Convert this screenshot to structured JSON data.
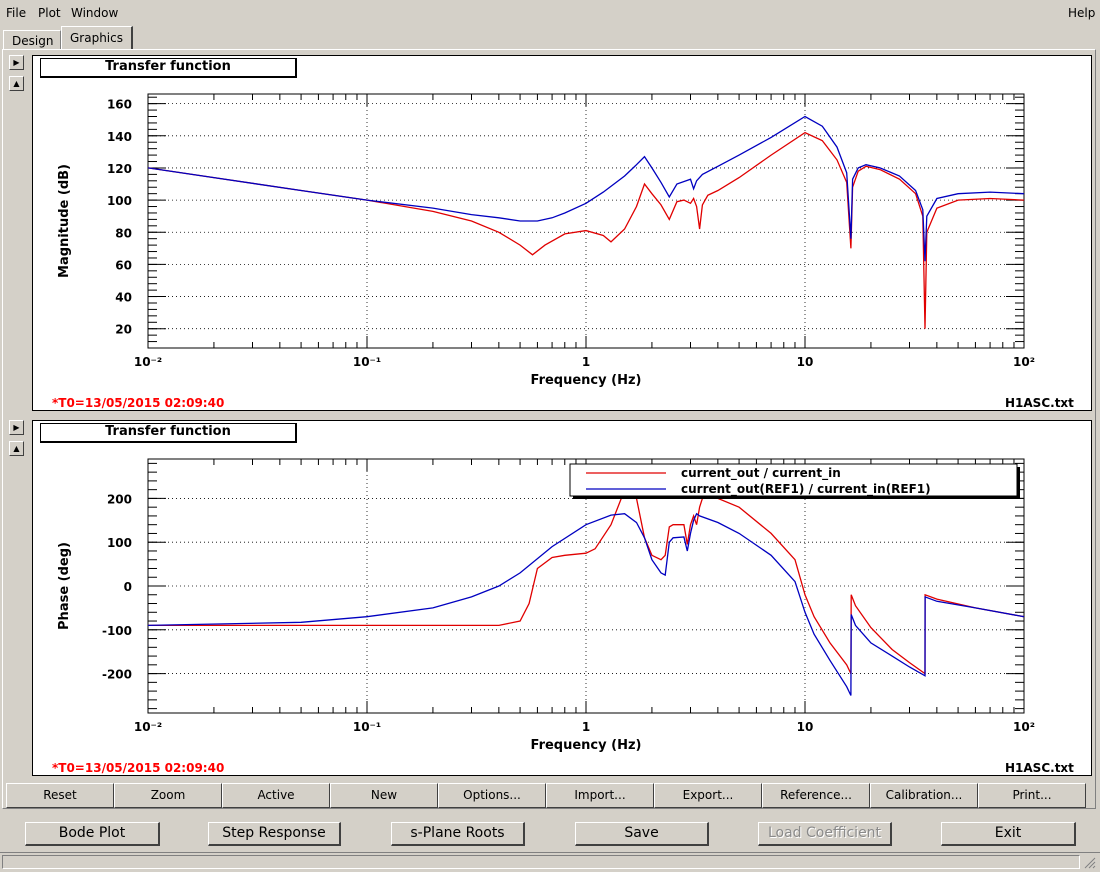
{
  "menu": {
    "file": "File",
    "plot": "Plot",
    "window": "Window",
    "help": "Help"
  },
  "tabs": [
    {
      "label": "Design"
    },
    {
      "label": "Graphics"
    }
  ],
  "panels": {
    "up_arrow": "▲",
    "down_arrow": "▲",
    "right_arrow": "▶"
  },
  "footer_info": {
    "t0": "*T0=13/05/2015 02:09:40",
    "filename": "H1ASC.txt"
  },
  "toolbar": [
    "Reset",
    "Zoom",
    "Active",
    "New",
    "Options...",
    "Import...",
    "Export...",
    "Reference...",
    "Calibration...",
    "Print..."
  ],
  "actions": {
    "bode": "Bode Plot",
    "step": "Step Response",
    "splane": "s-Plane Roots",
    "save": "Save",
    "load": "Load Coefficient",
    "exit": "Exit"
  },
  "colors": {
    "series1": "#e00000",
    "series2": "#0000c0"
  },
  "chart_data": [
    {
      "type": "line",
      "title": "Transfer function",
      "xlabel": "Frequency (Hz)",
      "ylabel": "Magnitude (dB)",
      "xscale": "log",
      "xlim": [
        0.01,
        100
      ],
      "ylim": [
        8,
        166
      ],
      "xticks": [
        0.01,
        0.1,
        1,
        10,
        100
      ],
      "xticklabels": [
        "10⁻²",
        "10⁻¹",
        "1",
        "10",
        "10²"
      ],
      "yticks": [
        20,
        40,
        60,
        80,
        100,
        120,
        140,
        160
      ],
      "grid": true,
      "series": [
        {
          "name": "current_out / current_in",
          "x": [
            0.01,
            0.02,
            0.05,
            0.1,
            0.2,
            0.3,
            0.4,
            0.5,
            0.57,
            0.65,
            0.8,
            1.0,
            1.2,
            1.3,
            1.5,
            1.7,
            1.85,
            2.0,
            2.2,
            2.4,
            2.6,
            2.8,
            3.0,
            3.1,
            3.2,
            3.3,
            3.4,
            3.6,
            4.0,
            5.0,
            7.0,
            10.0,
            12.0,
            14.0,
            15.5,
            16.2,
            16.5,
            17.5,
            19.0,
            22.0,
            27.0,
            32.0,
            34.5,
            35.3,
            36.0,
            40.0,
            50.0,
            70.0,
            100.0
          ],
          "y": [
            120,
            114,
            106,
            100,
            93,
            87,
            80,
            72,
            66,
            72,
            79,
            81,
            78,
            74,
            82,
            96,
            110,
            104,
            97,
            88,
            99,
            100,
            98,
            101,
            96,
            82,
            97,
            103,
            106,
            114,
            128,
            142,
            137,
            125,
            111,
            70,
            108,
            118,
            121,
            119,
            113,
            104,
            90,
            20,
            80,
            95,
            100,
            101,
            100
          ]
        },
        {
          "name": "current_out(REF1) / current_in(REF1)",
          "x": [
            0.01,
            0.02,
            0.05,
            0.1,
            0.2,
            0.3,
            0.4,
            0.5,
            0.6,
            0.7,
            0.8,
            1.0,
            1.2,
            1.5,
            1.7,
            1.85,
            2.0,
            2.2,
            2.4,
            2.6,
            3.0,
            3.1,
            3.2,
            3.4,
            4.0,
            5.0,
            7.0,
            10.0,
            12.0,
            14.0,
            15.5,
            16.2,
            16.5,
            17.5,
            19.0,
            22.0,
            27.0,
            32.0,
            34.5,
            35.3,
            36.0,
            40.0,
            50.0,
            70.0,
            100.0
          ],
          "y": [
            120,
            114,
            106,
            100,
            95,
            91,
            89,
            87,
            87,
            89,
            92,
            98,
            105,
            115,
            122,
            127,
            120,
            111,
            102,
            110,
            113,
            107,
            112,
            116,
            121,
            128,
            139,
            152,
            146,
            133,
            117,
            76,
            113,
            120,
            122,
            120,
            115,
            106,
            94,
            62,
            90,
            101,
            104,
            105,
            104
          ]
        }
      ]
    },
    {
      "type": "line",
      "title": "Transfer function",
      "xlabel": "Frequency (Hz)",
      "ylabel": "Phase (deg)",
      "xscale": "log",
      "xlim": [
        0.01,
        100
      ],
      "ylim": [
        -290,
        290
      ],
      "xticks": [
        0.01,
        0.1,
        1,
        10,
        100
      ],
      "xticklabels": [
        "10⁻²",
        "10⁻¹",
        "1",
        "10",
        "10²"
      ],
      "yticks": [
        -200,
        -100,
        0,
        100,
        200
      ],
      "grid": true,
      "legend": "top-right",
      "series": [
        {
          "name": "current_out / current_in",
          "x": [
            0.01,
            0.05,
            0.2,
            0.4,
            0.5,
            0.55,
            0.6,
            0.7,
            0.8,
            1.0,
            1.1,
            1.3,
            1.45,
            1.7,
            1.85,
            2.0,
            2.2,
            2.3,
            2.4,
            2.5,
            2.8,
            2.9,
            3.0,
            3.1,
            3.2,
            3.3,
            3.4,
            4.0,
            5.0,
            7.0,
            9.0,
            10.0,
            11.0,
            13.0,
            15.5,
            16.2,
            16.25,
            17.0,
            20.0,
            25.0,
            30.0,
            35.3,
            35.35,
            40.0,
            60.0,
            100.0
          ],
          "y": [
            -90,
            -90,
            -90,
            -90,
            -80,
            -40,
            40,
            65,
            70,
            75,
            85,
            140,
            200,
            200,
            110,
            70,
            60,
            70,
            135,
            140,
            140,
            95,
            140,
            160,
            140,
            180,
            200,
            200,
            180,
            120,
            60,
            -20,
            -70,
            -130,
            -180,
            -200,
            -20,
            -45,
            -95,
            -145,
            -175,
            -200,
            -20,
            -30,
            -50,
            -70
          ]
        },
        {
          "name": "current_out(REF1) / current_in(REF1)",
          "x": [
            0.01,
            0.05,
            0.1,
            0.2,
            0.3,
            0.4,
            0.5,
            0.7,
            1.0,
            1.3,
            1.5,
            1.7,
            1.85,
            2.0,
            2.2,
            2.3,
            2.4,
            2.5,
            2.8,
            2.9,
            3.0,
            3.1,
            3.2,
            3.3,
            4.0,
            5.0,
            7.0,
            9.0,
            10.0,
            11.0,
            13.0,
            15.5,
            16.2,
            16.25,
            17.0,
            20.0,
            25.0,
            30.0,
            35.3,
            35.35,
            40.0,
            60.0,
            100.0
          ],
          "y": [
            -90,
            -83,
            -70,
            -50,
            -25,
            0,
            30,
            90,
            140,
            162,
            165,
            145,
            110,
            60,
            30,
            25,
            100,
            110,
            112,
            80,
            120,
            150,
            165,
            160,
            145,
            120,
            70,
            10,
            -60,
            -110,
            -170,
            -230,
            -250,
            -65,
            -90,
            -130,
            -160,
            -185,
            -205,
            -25,
            -35,
            -50,
            -70
          ]
        }
      ]
    }
  ]
}
